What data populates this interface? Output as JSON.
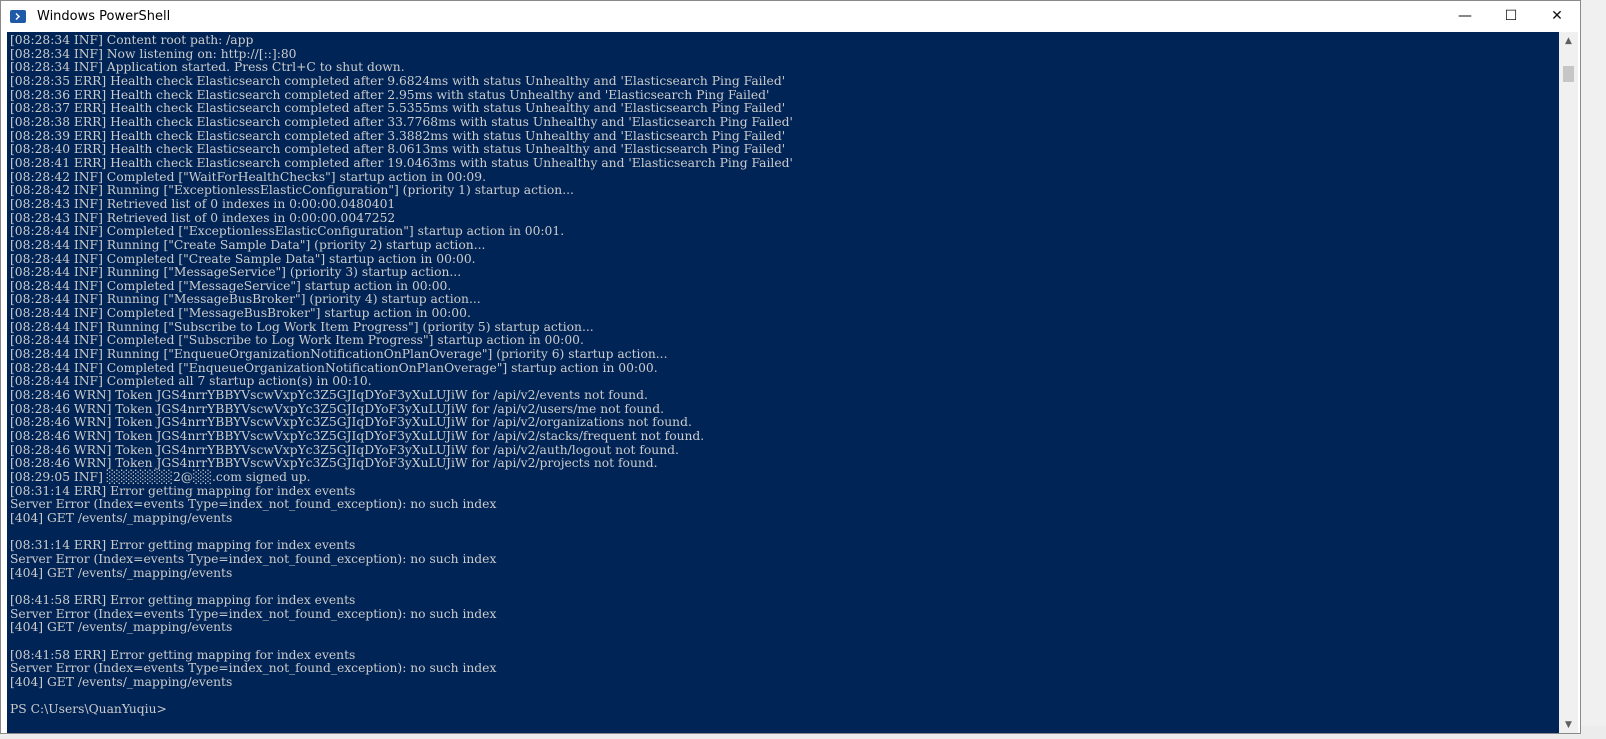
{
  "window": {
    "title": "Windows PowerShell",
    "icon": "powershell-icon",
    "controls": {
      "minimize": "—",
      "maximize": "☐",
      "close": "✕"
    }
  },
  "console": {
    "background": "#012456",
    "foreground": "#cccccc",
    "lines": [
      "[08:28:34 INF] Content root path: /app",
      "[08:28:34 INF] Now listening on: http://[::]:80",
      "[08:28:34 INF] Application started. Press Ctrl+C to shut down.",
      "[08:28:35 ERR] Health check Elasticsearch completed after 9.6824ms with status Unhealthy and 'Elasticsearch Ping Failed'",
      "[08:28:36 ERR] Health check Elasticsearch completed after 2.95ms with status Unhealthy and 'Elasticsearch Ping Failed'",
      "[08:28:37 ERR] Health check Elasticsearch completed after 5.5355ms with status Unhealthy and 'Elasticsearch Ping Failed'",
      "[08:28:38 ERR] Health check Elasticsearch completed after 33.7768ms with status Unhealthy and 'Elasticsearch Ping Failed'",
      "[08:28:39 ERR] Health check Elasticsearch completed after 3.3882ms with status Unhealthy and 'Elasticsearch Ping Failed'",
      "[08:28:40 ERR] Health check Elasticsearch completed after 8.0613ms with status Unhealthy and 'Elasticsearch Ping Failed'",
      "[08:28:41 ERR] Health check Elasticsearch completed after 19.0463ms with status Unhealthy and 'Elasticsearch Ping Failed'",
      "[08:28:42 INF] Completed [\"WaitForHealthChecks\"] startup action in 00:09.",
      "[08:28:42 INF] Running [\"ExceptionlessElasticConfiguration\"] (priority 1) startup action...",
      "[08:28:43 INF] Retrieved list of 0 indexes in 0:00:00.0480401",
      "[08:28:43 INF] Retrieved list of 0 indexes in 0:00:00.0047252",
      "[08:28:44 INF] Completed [\"ExceptionlessElasticConfiguration\"] startup action in 00:01.",
      "[08:28:44 INF] Running [\"Create Sample Data\"] (priority 2) startup action...",
      "[08:28:44 INF] Completed [\"Create Sample Data\"] startup action in 00:00.",
      "[08:28:44 INF] Running [\"MessageService\"] (priority 3) startup action...",
      "[08:28:44 INF] Completed [\"MessageService\"] startup action in 00:00.",
      "[08:28:44 INF] Running [\"MessageBusBroker\"] (priority 4) startup action...",
      "[08:28:44 INF] Completed [\"MessageBusBroker\"] startup action in 00:00.",
      "[08:28:44 INF] Running [\"Subscribe to Log Work Item Progress\"] (priority 5) startup action...",
      "[08:28:44 INF] Completed [\"Subscribe to Log Work Item Progress\"] startup action in 00:00.",
      "[08:28:44 INF] Running [\"EnqueueOrganizationNotificationOnPlanOverage\"] (priority 6) startup action...",
      "[08:28:44 INF] Completed [\"EnqueueOrganizationNotificationOnPlanOverage\"] startup action in 00:00.",
      "[08:28:44 INF] Completed all 7 startup action(s) in 00:10.",
      "[08:28:46 WRN] Token JGS4nrrYBBYVscwVxpYc3Z5GJIqDYoF3yXuLUJiW for /api/v2/events not found.",
      "[08:28:46 WRN] Token JGS4nrrYBBYVscwVxpYc3Z5GJIqDYoF3yXuLUJiW for /api/v2/users/me not found.",
      "[08:28:46 WRN] Token JGS4nrrYBBYVscwVxpYc3Z5GJIqDYoF3yXuLUJiW for /api/v2/organizations not found.",
      "[08:28:46 WRN] Token JGS4nrrYBBYVscwVxpYc3Z5GJIqDYoF3yXuLUJiW for /api/v2/stacks/frequent not found.",
      "[08:28:46 WRN] Token JGS4nrrYBBYVscwVxpYc3Z5GJIqDYoF3yXuLUJiW for /api/v2/auth/logout not found.",
      "[08:28:46 WRN] Token JGS4nrrYBBYVscwVxpYc3Z5GJIqDYoF3yXuLUJiW for /api/v2/projects not found.",
      "[08:29:05 INF] ░░░░░░░2@░░.com signed up.",
      "[08:31:14 ERR] Error getting mapping for index events",
      "Server Error (Index=events Type=index_not_found_exception): no such index",
      "[404] GET /events/_mapping/events",
      "",
      "[08:31:14 ERR] Error getting mapping for index events",
      "Server Error (Index=events Type=index_not_found_exception): no such index",
      "[404] GET /events/_mapping/events",
      "",
      "[08:41:58 ERR] Error getting mapping for index events",
      "Server Error (Index=events Type=index_not_found_exception): no such index",
      "[404] GET /events/_mapping/events",
      "",
      "[08:41:58 ERR] Error getting mapping for index events",
      "Server Error (Index=events Type=index_not_found_exception): no such index",
      "[404] GET /events/_mapping/events",
      "",
      "PS C:\\Users\\QuanYuqiu>"
    ]
  },
  "scrollbar": {
    "up_icon": "▲",
    "down_icon": "▼"
  }
}
